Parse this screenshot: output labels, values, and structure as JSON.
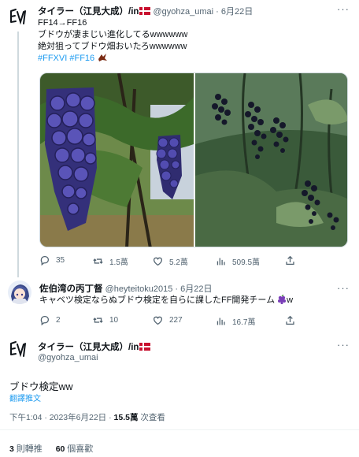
{
  "tweet1": {
    "name": "タイラー（江見大成）/in",
    "handle": "@gyohza_umai",
    "dot": "·",
    "date": "6月22日",
    "lines": [
      "FF14→FF16",
      "ブドウが凄まじい進化してるwwwwww",
      "絶対狙ってブドウ畑おいたろwwwwww"
    ],
    "hashtags": [
      "#FFXVI",
      "#FF16"
    ],
    "actions": {
      "replies": "35",
      "retweets": "1.5萬",
      "likes": "5.2萬",
      "views": "509.5萬"
    }
  },
  "reply": {
    "name": "佐伯湾の丙丁督",
    "handle": "@heyteitoku2015",
    "dot": "·",
    "date": "6月22日",
    "text": "キャベツ検定ならぬブドウ検定を自らに課したFF開発チーム",
    "suffix": "w",
    "actions": {
      "replies": "2",
      "retweets": "10",
      "likes": "227",
      "views": "16.7萬"
    }
  },
  "tweet2": {
    "name": "タイラー（江見大成）/in",
    "handle": "@gyohza_umai",
    "text": "ブドウ検定ww",
    "translate": "翻譯推文",
    "time": "下午1:04",
    "sep": "·",
    "date": "2023年6月22日",
    "views_count": "15.5萬",
    "views_label": "次查看",
    "retweets_count": "3",
    "retweets_label": "則轉推",
    "likes_count": "60",
    "likes_label": "個喜歡"
  },
  "colors": {
    "accent": "#1d9bf0",
    "muted": "#536471",
    "border": "#eff3f4"
  }
}
